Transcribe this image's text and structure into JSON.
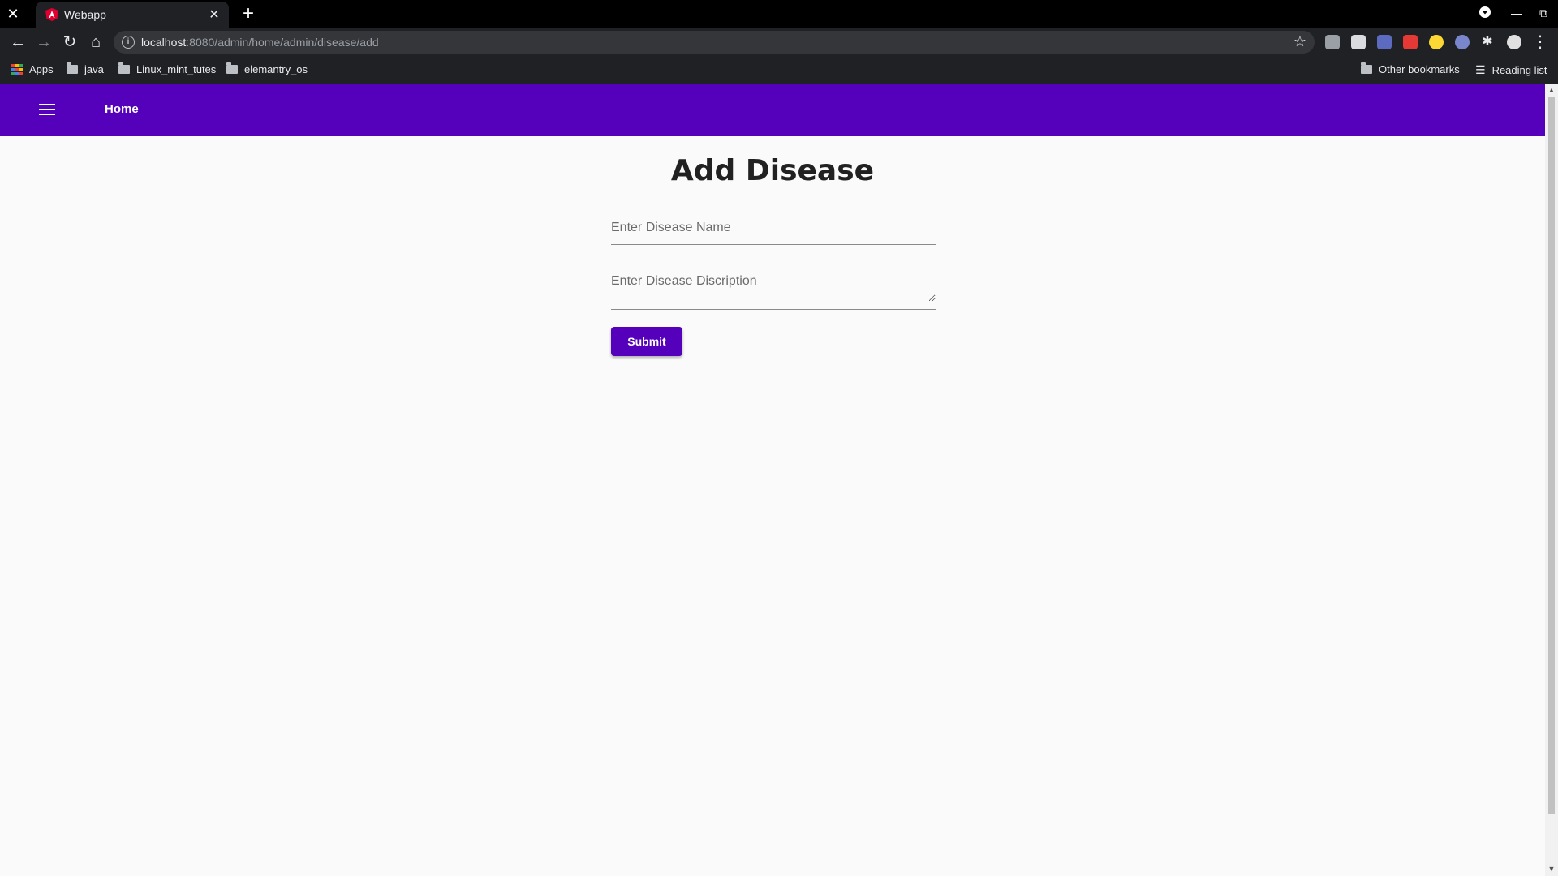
{
  "browser": {
    "tab_title": "Webapp",
    "url_host": "localhost",
    "url_path": ":8080/admin/home/admin/disease/add",
    "bookmarks": [
      "Apps",
      "java",
      "Linux_mint_tutes",
      "elemantry_os"
    ],
    "other_bookmarks": "Other bookmarks",
    "reading_list": "Reading list"
  },
  "appbar": {
    "home_label": "Home",
    "color": "#5500bb"
  },
  "form": {
    "title": "Add Disease",
    "name_placeholder": "Enter Disease Name",
    "description_placeholder": "Enter Disease Discription",
    "submit_label": "Submit"
  }
}
